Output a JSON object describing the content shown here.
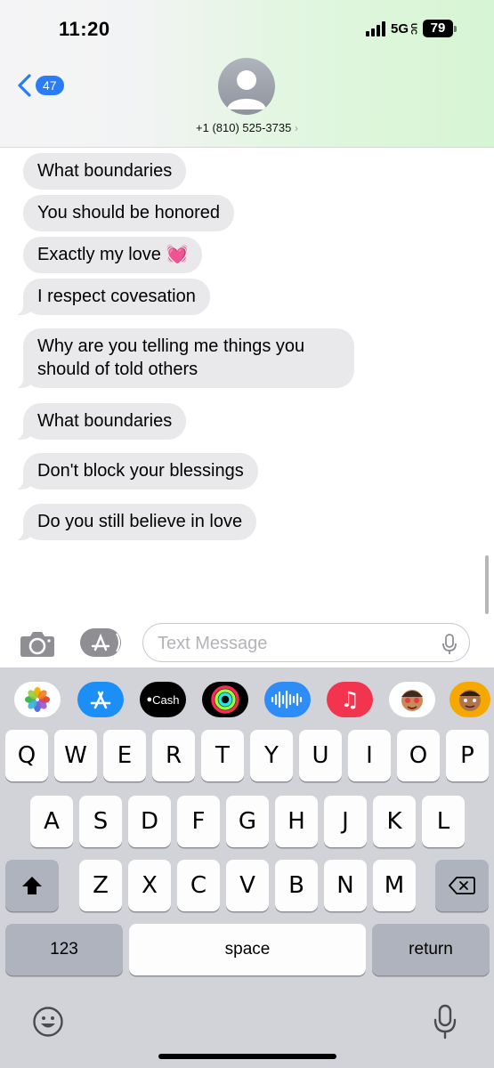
{
  "status_bar": {
    "time": "11:20",
    "network": "5G",
    "network_suffix": "UC",
    "battery": "79"
  },
  "header": {
    "back_count": "47",
    "contact_name": "+1 (810) 525-3735",
    "contact_chevron": "›"
  },
  "messages": [
    {
      "text": "What boundaries",
      "tail": false
    },
    {
      "text": "You should be honored",
      "tail": false
    },
    {
      "text": "Exactly my love 💓",
      "tail": false
    },
    {
      "text": "I respect covesation",
      "tail": true
    },
    {
      "text": "Why are you telling me things you should of told others",
      "tail": true
    },
    {
      "text": "What boundaries",
      "tail": true
    },
    {
      "text": "Don't block your blessings",
      "tail": true
    },
    {
      "text": "Do you still believe in love",
      "tail": true
    }
  ],
  "composer": {
    "placeholder": "Text Message"
  },
  "app_strip": [
    {
      "name": "photos",
      "label": ""
    },
    {
      "name": "app-store",
      "label": ""
    },
    {
      "name": "apple-cash",
      "label": "Cash"
    },
    {
      "name": "activity",
      "label": ""
    },
    {
      "name": "audio-message",
      "label": ""
    },
    {
      "name": "music",
      "label": "♫"
    },
    {
      "name": "memoji",
      "label": ""
    },
    {
      "name": "memoji-2",
      "label": ""
    }
  ],
  "keyboard": {
    "row1": [
      "Q",
      "W",
      "E",
      "R",
      "T",
      "Y",
      "U",
      "I",
      "O",
      "P"
    ],
    "row2": [
      "A",
      "S",
      "D",
      "F",
      "G",
      "H",
      "J",
      "K",
      "L"
    ],
    "row3": [
      "Z",
      "X",
      "C",
      "V",
      "B",
      "N",
      "M"
    ],
    "numbers_label": "123",
    "space_label": "space",
    "return_label": "return"
  },
  "colors": {
    "bubble": "#e9e9eb",
    "accent": "#2a7cf6",
    "keyboard_bg": "#d1d3d9"
  }
}
